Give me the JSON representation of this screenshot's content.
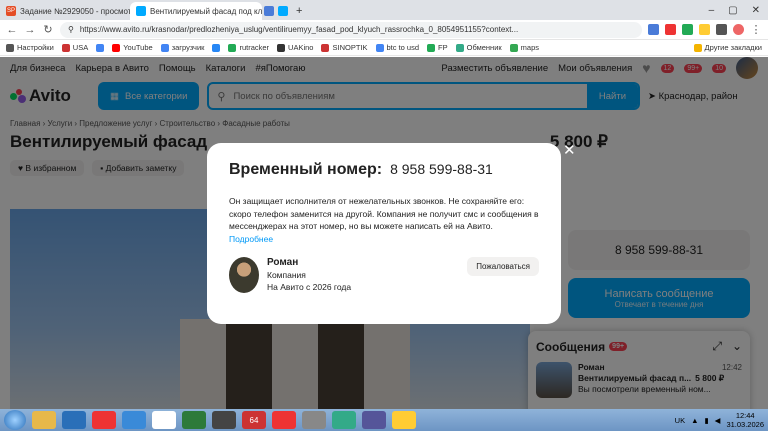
{
  "browser": {
    "tabs": [
      {
        "label": "Задание №2929050 - просмотр з",
        "color": "#e44d26",
        "fav_text": "SP"
      },
      {
        "label": "Вентилируемый фасад под ключ",
        "color": "#00aaff",
        "fav_text": ""
      },
      {
        "label": "",
        "color": "#4a7bd8",
        "fav_text": ""
      },
      {
        "label": "",
        "color": "#00aaff",
        "fav_text": ""
      }
    ],
    "url": "https://www.avito.ru/krasnodar/predlozheniya_uslug/ventiliruemyy_fasad_pod_klyuch_rassrochka_0_8054951155?context...",
    "bookmarks": [
      {
        "label": "Настройки",
        "color": "#555"
      },
      {
        "label": "USA",
        "color": "#c33"
      },
      {
        "label": "",
        "color": "#4285f4"
      },
      {
        "label": "YouTube",
        "color": "#f00"
      },
      {
        "label": "загрузчик",
        "color": "#4285f4"
      },
      {
        "label": "",
        "color": "#2787f5"
      },
      {
        "label": "rutracker",
        "color": "#2a5"
      },
      {
        "label": "UAKino",
        "color": "#333"
      },
      {
        "label": "SINOPTIK",
        "color": "#c33"
      },
      {
        "label": "btc to usd",
        "color": "#4285f4"
      },
      {
        "label": "FP",
        "color": "#2a5"
      },
      {
        "label": "Обменник",
        "color": "#3a8"
      },
      {
        "label": "maps",
        "color": "#34a853"
      },
      {
        "label": "Другие закладки",
        "color": "#f4b400"
      }
    ]
  },
  "avito": {
    "topnav": {
      "business": "Для бизнеса",
      "career": "Карьера в Авито",
      "help": "Помощь",
      "catalogs": "Каталоги",
      "tag": "#яПомогаю",
      "post_ad": "Разместить объявление",
      "my_ads": "Мои объявления",
      "badge_1": "12",
      "badge_2": "99+",
      "badge_3": "10"
    },
    "logo": "Avito",
    "categories_button": "Все категории",
    "search_placeholder": "Поиск по объявлениям",
    "search_button": "Найти",
    "location": "Краснодар, район",
    "breadcrumbs": "Главная › Услуги › Предложение услуг › Строительство › Фасадные работы",
    "title": "Вентилируемый фасад",
    "price": "5 800 ₽",
    "favorite": "В избранном",
    "add_note": "Добавить заметку",
    "phone": "8 958 599-88-31",
    "write_message": "Написать сообщение",
    "reply_time": "Отвечает в течение дня",
    "messages_panel": {
      "title": "Сообщения",
      "badge": "99+",
      "name": "Роман",
      "time": "12:42",
      "subject": "Вентилируемый фасад п...",
      "price": "5 800 ₽",
      "last": "Вы посмотрели временный ном..."
    }
  },
  "modal": {
    "title": "Временный номер:",
    "number": "8 958 599-88-31",
    "text": "Он защищает исполнителя от нежелательных звонков. Не сохраняйте его: скоро телефон заменится на другой. Компания не получит смс и сообщения в мессенджерах на этот номер, но вы можете написать ей на Авито.",
    "more_link": "Подробнее",
    "seller_name": "Роман",
    "seller_type": "Компания",
    "seller_since": "На Авито с 2026 года",
    "complain": "Пожаловаться"
  },
  "taskbar": {
    "lang": "UK",
    "time": "12:44",
    "date": "31.03.2026",
    "icons": [
      {
        "name": "explorer-icon",
        "color": "#e7b84a",
        "text": ""
      },
      {
        "name": "app-icon",
        "color": "#2a6fb8",
        "text": ""
      },
      {
        "name": "chrome-icon",
        "color": "#e33",
        "text": ""
      },
      {
        "name": "network-icon",
        "color": "#3a8ad8",
        "text": ""
      },
      {
        "name": "yandex-icon",
        "color": "#fff",
        "text": ""
      },
      {
        "name": "app2-icon",
        "color": "#2d7a3a",
        "text": ""
      },
      {
        "name": "app3-icon",
        "color": "#444",
        "text": ""
      },
      {
        "name": "app-64-icon",
        "color": "#c33",
        "text": "64"
      },
      {
        "name": "app4-icon",
        "color": "#e33",
        "text": ""
      },
      {
        "name": "app5-icon",
        "color": "#888",
        "text": ""
      },
      {
        "name": "app6-icon",
        "color": "#3a8",
        "text": ""
      },
      {
        "name": "app7-icon",
        "color": "#559",
        "text": ""
      },
      {
        "name": "app8-icon",
        "color": "#fc3",
        "text": ""
      }
    ]
  }
}
